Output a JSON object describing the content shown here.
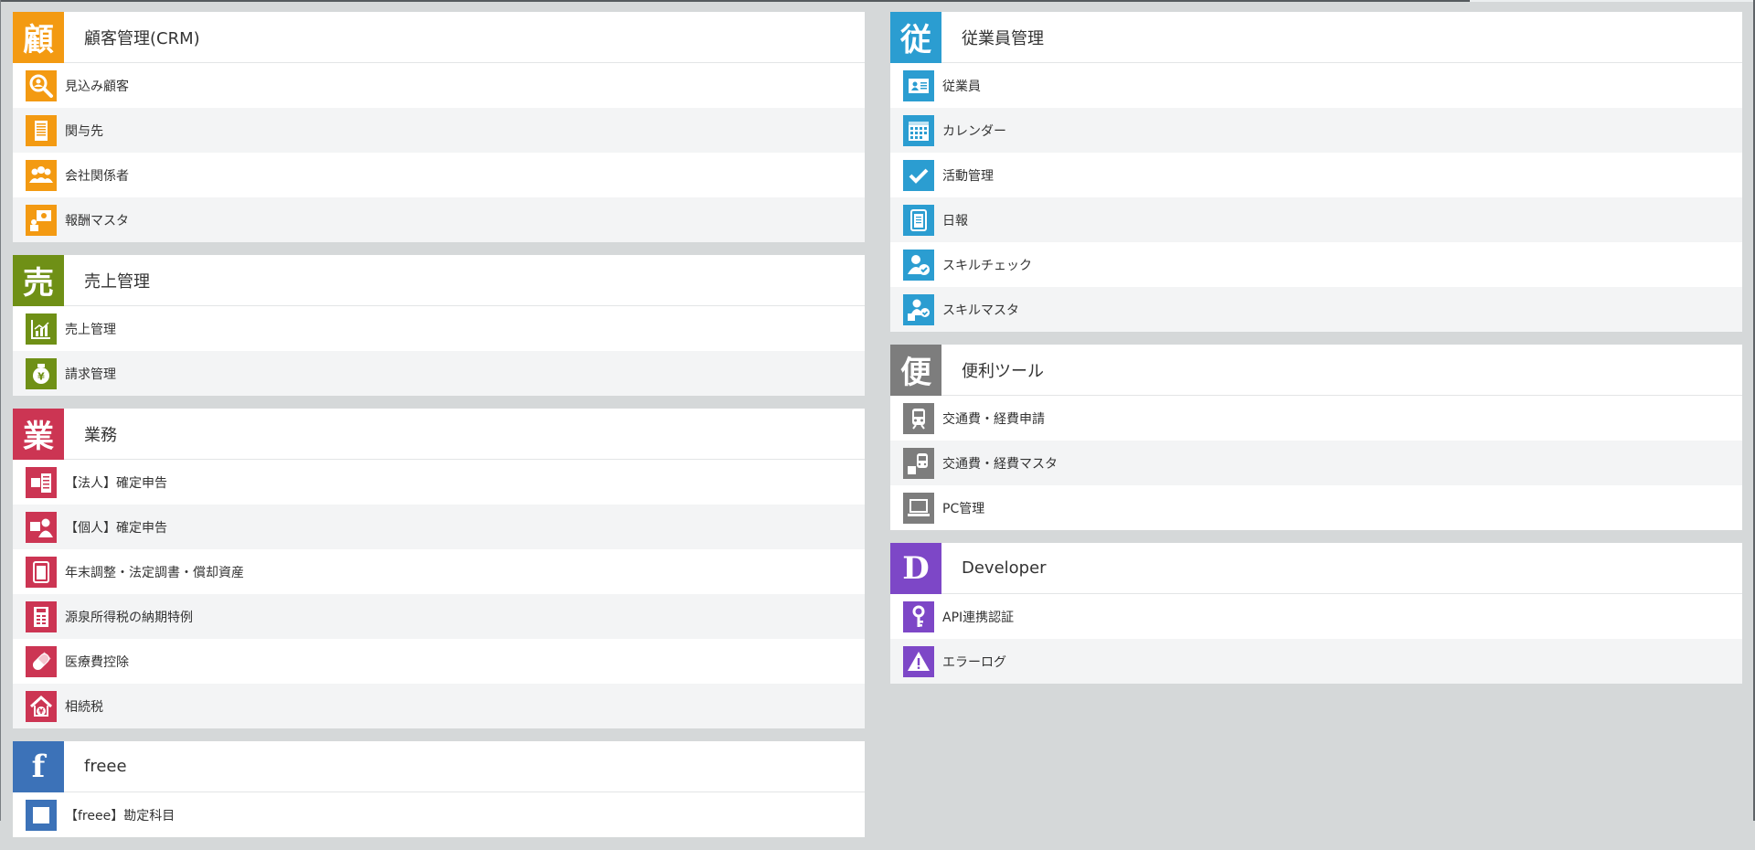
{
  "colors": {
    "crm": "#f39a12",
    "sales": "#6f9016",
    "business": "#cc3553",
    "freee": "#3c72b8",
    "employee": "#2b9dd1",
    "tools": "#7d7d7d",
    "developer": "#7d47c7"
  },
  "left": {
    "crm": {
      "badge": "顧",
      "title": "顧客管理(CRM)",
      "items": [
        {
          "label": "見込み顧客",
          "icon": "search-person-icon"
        },
        {
          "label": "関与先",
          "icon": "building-icon"
        },
        {
          "label": "会社関係者",
          "icon": "people-icon"
        },
        {
          "label": "報酬マスタ",
          "icon": "reward-icon"
        }
      ]
    },
    "sales": {
      "badge": "売",
      "title": "売上管理",
      "items": [
        {
          "label": "売上管理",
          "icon": "chart-icon"
        },
        {
          "label": "請求管理",
          "icon": "yen-bag-icon"
        }
      ]
    },
    "business": {
      "badge": "業",
      "title": "業務",
      "items": [
        {
          "label": "【法人】確定申告",
          "icon": "tax-building-icon"
        },
        {
          "label": "【個人】確定申告",
          "icon": "tax-person-icon"
        },
        {
          "label": "年末調整・法定調書・償却資産",
          "icon": "documents-icon"
        },
        {
          "label": "源泉所得税の納期特例",
          "icon": "tax-sheet-icon"
        },
        {
          "label": "医療費控除",
          "icon": "pill-icon"
        },
        {
          "label": "相続税",
          "icon": "house-yen-icon"
        }
      ]
    },
    "freee": {
      "badge": "f",
      "title": "freee",
      "items": [
        {
          "label": "【freee】勘定科目",
          "icon": "ledger-icon"
        }
      ]
    }
  },
  "right": {
    "employee": {
      "badge": "従",
      "title": "従業員管理",
      "items": [
        {
          "label": "従業員",
          "icon": "id-card-icon"
        },
        {
          "label": "カレンダー",
          "icon": "calendar-icon"
        },
        {
          "label": "活動管理",
          "icon": "check-icon"
        },
        {
          "label": "日報",
          "icon": "report-icon"
        },
        {
          "label": "スキルチェック",
          "icon": "skill-check-icon"
        },
        {
          "label": "スキルマスタ",
          "icon": "skill-master-icon"
        }
      ]
    },
    "tools": {
      "badge": "便",
      "title": "便利ツール",
      "items": [
        {
          "label": "交通費・経費申請",
          "icon": "train-icon"
        },
        {
          "label": "交通費・経費マスタ",
          "icon": "train-master-icon"
        },
        {
          "label": "PC管理",
          "icon": "laptop-icon"
        }
      ]
    },
    "developer": {
      "badge": "D",
      "title": "Developer",
      "items": [
        {
          "label": "API連携認証",
          "icon": "key-icon"
        },
        {
          "label": "エラーログ",
          "icon": "warning-icon"
        }
      ]
    }
  }
}
